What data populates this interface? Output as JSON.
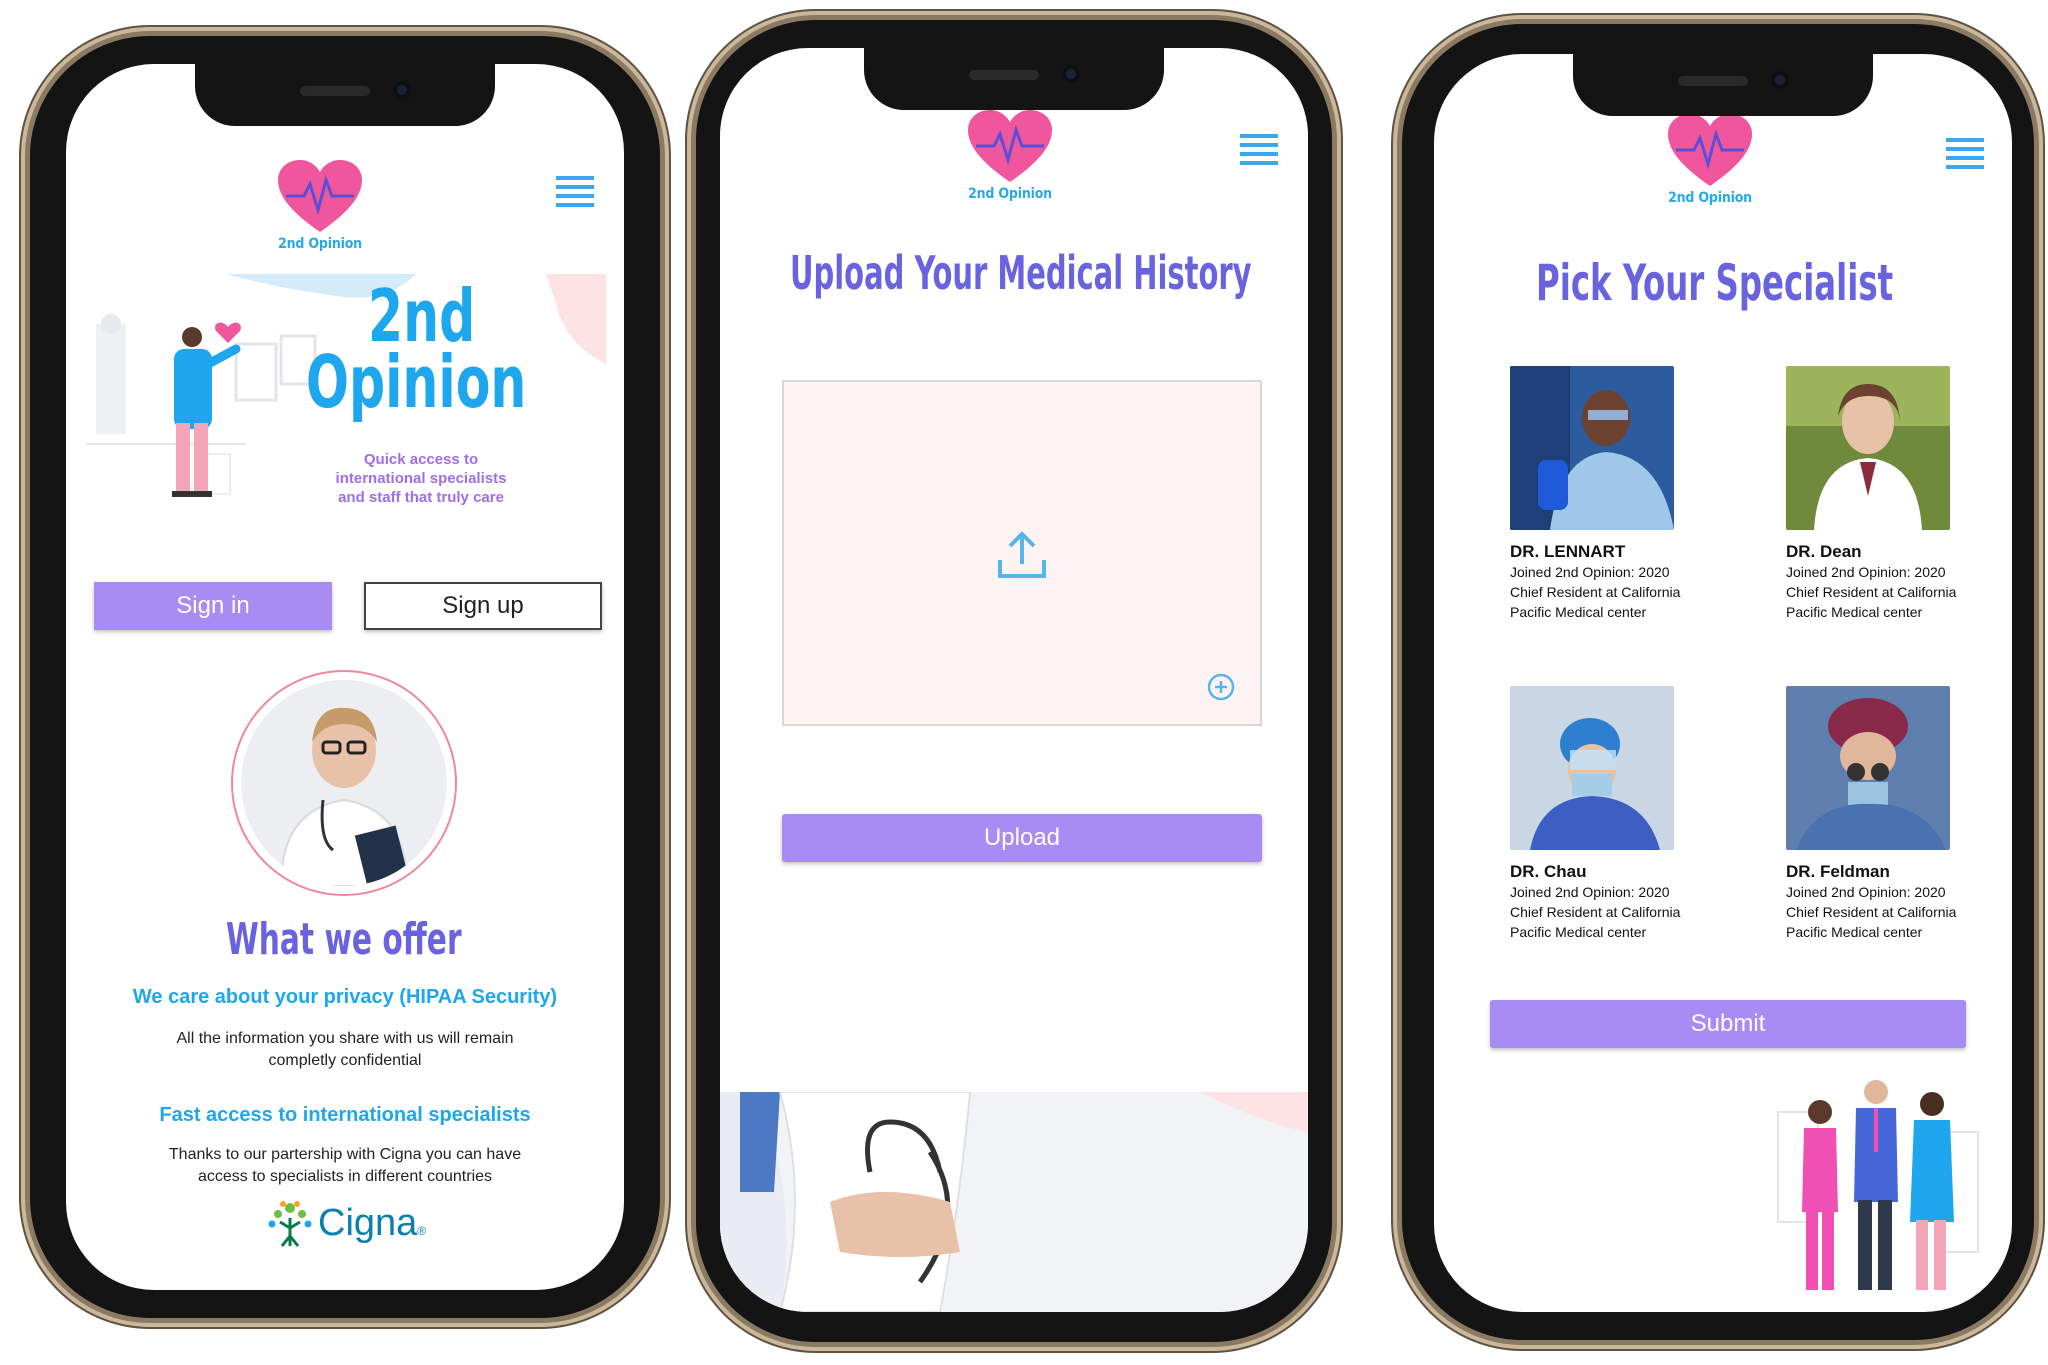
{
  "brand": {
    "logo_text": "2nd Opinion",
    "heart_color": "#f0569e",
    "accent_blue": "#1ea7ee",
    "accent_purple": "#a98bf4"
  },
  "screen1": {
    "hero_title_line1": "2nd",
    "hero_title_line2": "Opinion",
    "hero_tagline_1": "Quick access to",
    "hero_tagline_2": "international specialists",
    "hero_tagline_3": "and staff that truly care",
    "signin_label": "Sign in",
    "signup_label": "Sign up",
    "offer_heading": "What we offer",
    "privacy_heading": "We care about your privacy (HIPAA Security)",
    "privacy_text_1": "All the information you share with us will remain",
    "privacy_text_2": "completly confidential",
    "fast_heading": "Fast access to international specialists",
    "fast_text_1": "Thanks  to our partership with Cigna you can have",
    "fast_text_2": "access to specialists in different countries",
    "partner_logo": "Cigna",
    "partner_mark": "®"
  },
  "screen2": {
    "title": "Upload Your Medical History",
    "upload_button": "Upload",
    "icons": [
      "upload-icon",
      "zoom-in-icon"
    ]
  },
  "screen3": {
    "title": "Pick Your Specialist",
    "doctors": [
      {
        "name": "DR. LENNART",
        "joined": "Joined 2nd Opinion: 2020",
        "role_1": "Chief Resident at California",
        "role_2": "Pacific Medical center"
      },
      {
        "name": "DR. Dean",
        "joined": "Joined 2nd Opinion: 2020",
        "role_1": "Chief Resident at California",
        "role_2": "Pacific Medical center"
      },
      {
        "name": "DR. Chau",
        "joined": "Joined 2nd Opinion: 2020",
        "role_1": "Chief Resident at California",
        "role_2": "Pacific Medical center"
      },
      {
        "name": "DR. Feldman",
        "joined": "Joined 2nd Opinion: 2020",
        "role_1": "Chief Resident at California",
        "role_2": "Pacific Medical center"
      }
    ],
    "submit_button": "Submit"
  }
}
